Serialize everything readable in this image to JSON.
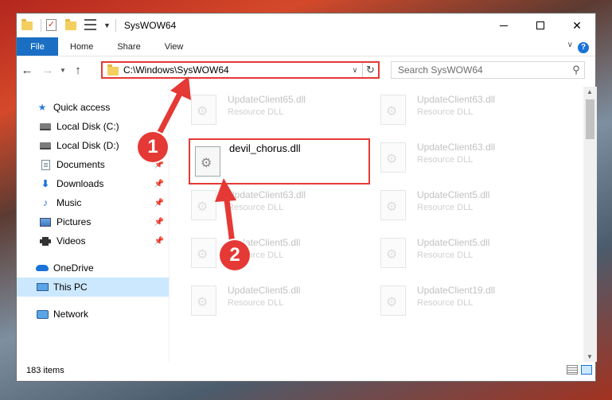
{
  "window": {
    "title": "SysWOW64"
  },
  "ribbon": {
    "tabs": [
      "File",
      "Home",
      "Share",
      "View"
    ]
  },
  "address": {
    "path": "C:\\Windows\\SysWOW64"
  },
  "search": {
    "placeholder": "Search SysWOW64"
  },
  "nav": {
    "quick_access": "Quick access",
    "items": [
      {
        "label": "Local Disk (C:)",
        "icon": "disk-icon",
        "pinned": false
      },
      {
        "label": "Local Disk (D:)",
        "icon": "disk-icon",
        "pinned": false
      },
      {
        "label": "Documents",
        "icon": "documents-icon",
        "pinned": true
      },
      {
        "label": "Downloads",
        "icon": "downloads-icon",
        "pinned": true
      },
      {
        "label": "Music",
        "icon": "music-icon",
        "pinned": true
      },
      {
        "label": "Pictures",
        "icon": "pictures-icon",
        "pinned": true
      },
      {
        "label": "Videos",
        "icon": "videos-icon",
        "pinned": true
      }
    ],
    "onedrive": "OneDrive",
    "this_pc": "This PC",
    "network": "Network"
  },
  "files": [
    {
      "name": "UpdateClient65.dll",
      "type": "Resource DLL"
    },
    {
      "name": "UpdateClient63.dll",
      "type": "Resource DLL"
    },
    {
      "name": "UpdateClient63.dll",
      "type": "Resource DLL"
    },
    {
      "name": "UpdateClient63.dll",
      "type": "Resource DLL"
    },
    {
      "name": "UpdateClient5.dll",
      "type": "Resource DLL"
    },
    {
      "name": "UpdateClient5.dll",
      "type": "Resource DLL"
    },
    {
      "name": "UpdateClient5.dll",
      "type": "Resource DLL"
    },
    {
      "name": "UpdateClient5.dll",
      "type": "Resource DLL"
    },
    {
      "name": "UpdateClient19.dll",
      "type": "Resource DLL"
    }
  ],
  "highlighted_file": {
    "name": "devil_chorus.dll"
  },
  "status": {
    "item_count": "183 items"
  },
  "annotations": {
    "step1": "1",
    "step2": "2",
    "color": "#e53935"
  }
}
